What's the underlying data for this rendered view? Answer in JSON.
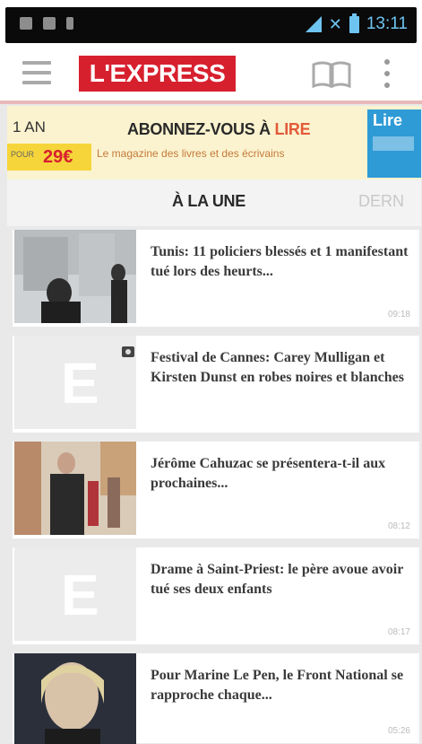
{
  "status_bar": {
    "time": "13:11",
    "icons": [
      "image-notification-icon",
      "bbm-notification-icon",
      "download-icon",
      "signal-icon",
      "airplane-mode-icon",
      "battery-icon"
    ]
  },
  "app_bar": {
    "logo": "L'EXPRESS",
    "icons": [
      "menu-icon",
      "book-icon",
      "more-vert-icon"
    ],
    "brand_color": "#d7202e"
  },
  "ad": {
    "term": "1 AN",
    "price_prefix": "POUR",
    "price": "29€",
    "headline": "ABONNEZ-VOUS À",
    "brand": "LIRE",
    "subtitle": "Le magazine des livres et des écrivains",
    "magazine_title": "Lire"
  },
  "tabs": {
    "active": "À LA UNE",
    "next": "DERN"
  },
  "articles": [
    {
      "headline": "Tunis: 11 policiers blessés et 1 manifestant tué lors des heurts...",
      "time": "09:18",
      "thumb": "photo"
    },
    {
      "headline": "Festival de Cannes: Carey Mulligan et Kirsten Dunst en robes noires et blanches",
      "time": "",
      "thumb": "placeholder"
    },
    {
      "headline": "Jérôme Cahuzac se présentera-t-il aux prochaines...",
      "time": "08:12",
      "thumb": "photo"
    },
    {
      "headline": "Drame à Saint-Priest: le père avoue avoir tué ses deux enfants",
      "time": "08:17",
      "thumb": "placeholder"
    },
    {
      "headline": "Pour Marine Le Pen, le Front National se rapproche chaque...",
      "time": "05:26",
      "thumb": "photo"
    }
  ]
}
